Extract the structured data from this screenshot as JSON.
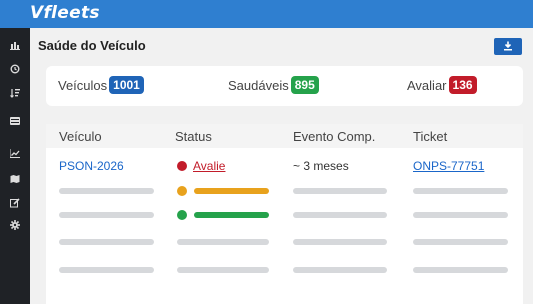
{
  "app": {
    "logo": "Vfleets"
  },
  "sidebar": {
    "icons": [
      "chart-icon",
      "history-icon",
      "sort-icon",
      "list-icon",
      "line-chart-icon",
      "map-icon",
      "edit-icon",
      "settings-icon"
    ]
  },
  "page": {
    "title": "Saúde do Veículo",
    "download_icon": "download-icon"
  },
  "summary": {
    "vehicles_label": "Veículos",
    "vehicles_count": "1001",
    "healthy_label": "Saudáveis",
    "healthy_count": "895",
    "evaluate_label": "Avaliar",
    "evaluate_count": "136"
  },
  "table": {
    "headers": [
      "Veículo",
      "Status",
      "Evento Comp.",
      "Ticket"
    ],
    "first_row": {
      "vehicle": "PSON-2026",
      "status": "Avalie",
      "event": "~ 3 meses",
      "ticket": "ONPS-77751"
    },
    "placeholder_rows": [
      {
        "status_color": "#e8a21d",
        "bar_level": 1.0
      },
      {
        "status_color": "#25a24b",
        "bar_level": 1.0
      },
      {
        "status_color": "",
        "bar_level": 0
      },
      {
        "status_color": "",
        "bar_level": 0
      }
    ]
  },
  "colors": {
    "brand": "#2f7fd0",
    "vehicles_badge": "#1f64b7",
    "healthy_badge": "#25a24b",
    "evaluate_badge": "#c21c2a",
    "status_red": "#c21c2a"
  }
}
